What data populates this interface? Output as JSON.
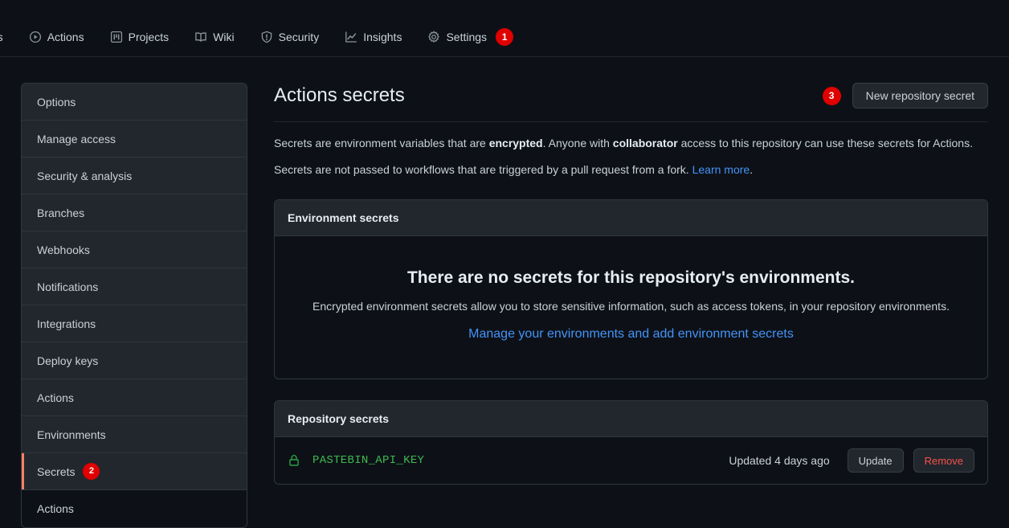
{
  "repo_nav": {
    "items": [
      {
        "label": "ests",
        "icon": "pull-request-icon",
        "icon_hidden": true,
        "badge": null
      },
      {
        "label": "Actions",
        "icon": "play-circle-icon",
        "badge": null
      },
      {
        "label": "Projects",
        "icon": "project-board-icon",
        "badge": null
      },
      {
        "label": "Wiki",
        "icon": "book-icon",
        "badge": null
      },
      {
        "label": "Security",
        "icon": "shield-icon",
        "badge": null
      },
      {
        "label": "Insights",
        "icon": "graph-icon",
        "badge": null
      },
      {
        "label": "Settings",
        "icon": "gear-icon",
        "badge": "1"
      }
    ]
  },
  "sidebar": {
    "items": [
      {
        "label": "Options",
        "badge": null,
        "selected": false,
        "sub": false
      },
      {
        "label": "Manage access",
        "badge": null,
        "selected": false,
        "sub": false
      },
      {
        "label": "Security & analysis",
        "badge": null,
        "selected": false,
        "sub": false
      },
      {
        "label": "Branches",
        "badge": null,
        "selected": false,
        "sub": false
      },
      {
        "label": "Webhooks",
        "badge": null,
        "selected": false,
        "sub": false
      },
      {
        "label": "Notifications",
        "badge": null,
        "selected": false,
        "sub": false
      },
      {
        "label": "Integrations",
        "badge": null,
        "selected": false,
        "sub": false
      },
      {
        "label": "Deploy keys",
        "badge": null,
        "selected": false,
        "sub": false
      },
      {
        "label": "Actions",
        "badge": null,
        "selected": false,
        "sub": false
      },
      {
        "label": "Environments",
        "badge": null,
        "selected": false,
        "sub": false
      },
      {
        "label": "Secrets",
        "badge": "2",
        "selected": true,
        "sub": false
      },
      {
        "label": "Actions",
        "badge": null,
        "selected": false,
        "sub": true
      }
    ]
  },
  "main": {
    "title": "Actions secrets",
    "header_badge": "3",
    "new_secret_button": "New repository secret",
    "description": {
      "line1_part1": "Secrets are environment variables that are ",
      "line1_bold1": "encrypted",
      "line1_part2": ". Anyone with ",
      "line1_bold2": "collaborator",
      "line1_part3": " access to this repository can use these secrets for Actions.",
      "line2_part1": "Secrets are not passed to workflows that are triggered by a pull request from a fork. ",
      "line2_link": "Learn more",
      "line2_part2": "."
    },
    "environment_panel": {
      "header": "Environment secrets",
      "empty_title": "There are no secrets for this repository's environments.",
      "empty_description": "Encrypted environment secrets allow you to store sensitive information, such as access tokens, in your repository environments.",
      "empty_link": "Manage your environments and add environment secrets"
    },
    "repository_panel": {
      "header": "Repository secrets",
      "secrets": [
        {
          "name": "PASTEBIN_API_KEY",
          "updated": "Updated 4 days ago",
          "update_label": "Update",
          "remove_label": "Remove"
        }
      ]
    }
  },
  "colors": {
    "page_bg": "#0d1117",
    "panel_bg": "#22272e",
    "border": "#30363d",
    "badge_red": "#e00000",
    "accent_orange": "#f78166",
    "link_blue": "#4493f8",
    "secret_green": "#3fb950",
    "danger_red": "#f85149"
  }
}
